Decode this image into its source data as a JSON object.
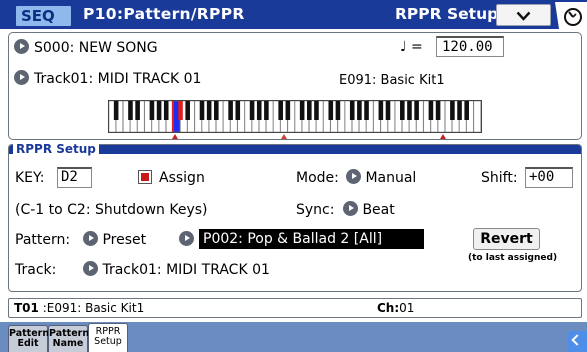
{
  "header": {
    "mode": "SEQ",
    "page_title": "P10:Pattern/RPPR",
    "section_title": "RPPR Setup",
    "menu_icon": "chevron-down-icon",
    "status_icon": "clock-icon"
  },
  "song": {
    "song_label": "S000: NEW SONG",
    "tempo_symbol": "♩ =",
    "tempo_value": "120.00",
    "track_label": "Track01: MIDI TRACK 01",
    "kit_label": "E091: Basic Kit1"
  },
  "rppr": {
    "legend": "RPPR Setup",
    "key_label": "KEY:",
    "key_value": "D2",
    "assign_label": "Assign",
    "assign_checked": true,
    "mode_label": "Mode:",
    "mode_value": "Manual",
    "shift_label": "Shift:",
    "shift_value": "+00",
    "shutdown_note": "(C-1 to C2: Shutdown Keys)",
    "sync_label": "Sync:",
    "sync_value": "Beat",
    "pattern_label": "Pattern:",
    "pattern_bank": "Preset",
    "pattern_value": "P002: Pop & Ballad 2 [All]",
    "revert_label": "Revert",
    "revert_note": "(to last assigned)",
    "track_label": "Track:",
    "track_value": "Track01: MIDI TRACK 01"
  },
  "info_bar": {
    "track": "T01",
    "program": " :E091: Basic Kit1",
    "ch_label": "Ch:",
    "ch_value": "01"
  },
  "tabs": [
    {
      "line1": "Pattern",
      "line2": "Edit",
      "active": false
    },
    {
      "line1": "Pattern",
      "line2": "Name",
      "active": false
    },
    {
      "line1": "RPPR",
      "line2": "Setup",
      "active": true
    }
  ],
  "colors": {
    "header_blue": "#1a3a9a",
    "seq_badge": "#8fb8ec",
    "tab_strip": "#6b8cc0",
    "assign_red": "#c81818",
    "key_highlight_blue": "#1c2cf0",
    "key_highlight_red": "#e02020"
  }
}
